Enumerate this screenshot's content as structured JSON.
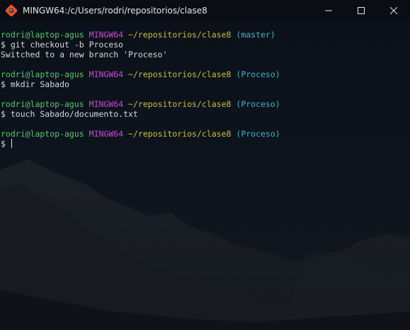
{
  "window": {
    "title": "MINGW64:/c/Users/rodri/repositorios/clase8",
    "controls": {
      "minimize_icon": "minimize-icon",
      "maximize_icon": "maximize-icon",
      "close_icon": "close-icon"
    }
  },
  "colors": {
    "user": "#58c66a",
    "system": "#c54bd6",
    "path": "#c9bf3c",
    "branch": "#3db5c9",
    "text": "#d8d8d8"
  },
  "terminal": {
    "blocks": [
      {
        "prompt": {
          "user": "rodri@laptop-agus",
          "system": "MINGW64",
          "path": "~/repositorios/clase8",
          "branch": "(master)"
        },
        "command": "$ git checkout -b Proceso",
        "output": "Switched to a new branch 'Proceso'"
      },
      {
        "prompt": {
          "user": "rodri@laptop-agus",
          "system": "MINGW64",
          "path": "~/repositorios/clase8",
          "branch": "(Proceso)"
        },
        "command": "$ mkdir Sabado"
      },
      {
        "prompt": {
          "user": "rodri@laptop-agus",
          "system": "MINGW64",
          "path": "~/repositorios/clase8",
          "branch": "(Proceso)"
        },
        "command": "$ touch Sabado/documento.txt"
      },
      {
        "prompt": {
          "user": "rodri@laptop-agus",
          "system": "MINGW64",
          "path": "~/repositorios/clase8",
          "branch": "(Proceso)"
        },
        "command": "$ "
      }
    ]
  }
}
